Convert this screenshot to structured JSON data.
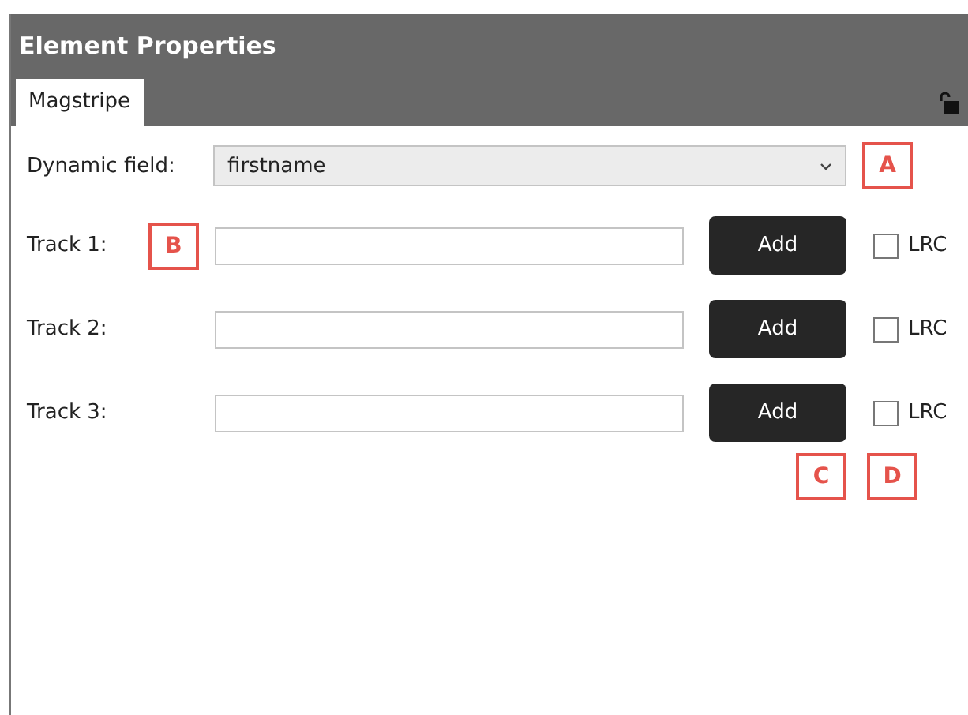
{
  "panel": {
    "title": "Element Properties"
  },
  "tabs": [
    {
      "label": "Magstripe",
      "selected": true
    }
  ],
  "dynamic_field": {
    "label": "Dynamic field:",
    "value": "firstname",
    "callout": "A"
  },
  "tracks": [
    {
      "label": "Track 1:",
      "callout": "B",
      "button": "Add",
      "checkbox": {
        "label": "LRC",
        "checked": false
      }
    },
    {
      "label": "Track 2:",
      "button": "Add",
      "checkbox": {
        "label": "LRC",
        "checked": false
      }
    },
    {
      "label": "Track 3:",
      "button": "Add",
      "checkbox": {
        "label": "LRC",
        "checked": false
      }
    }
  ],
  "bottom_callouts": [
    "C",
    "D"
  ]
}
